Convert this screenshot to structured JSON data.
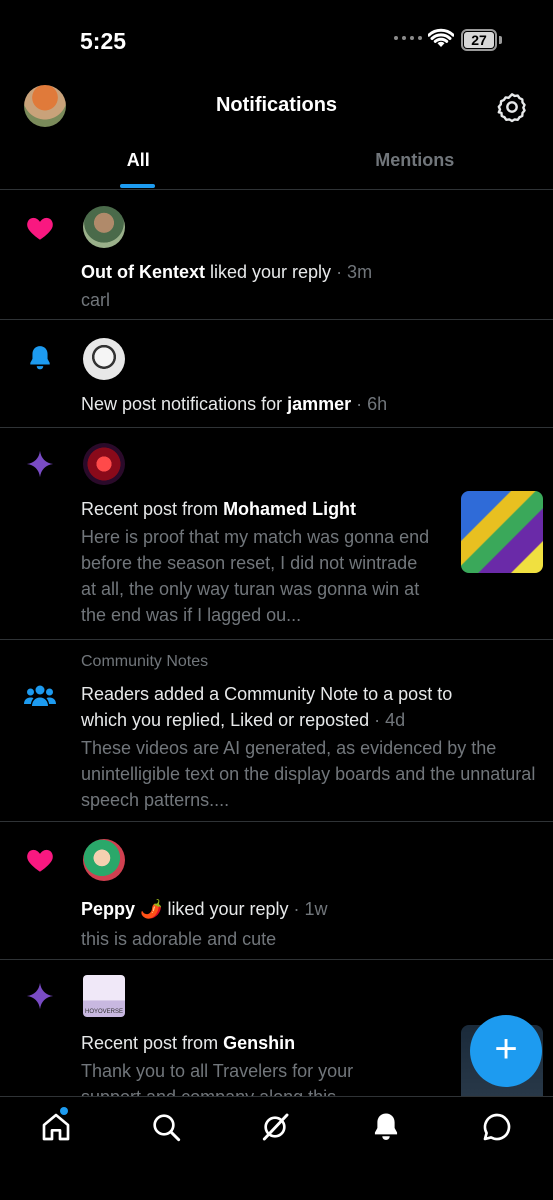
{
  "status": {
    "time": "5:25",
    "battery": "27"
  },
  "header": {
    "title": "Notifications"
  },
  "tabs": [
    {
      "label": "All"
    },
    {
      "label": "Mentions"
    }
  ],
  "notifications": [
    {
      "type": "like",
      "actor": "Out of Kentext",
      "action": " liked your reply",
      "time": " · 3m",
      "preview": "carl"
    },
    {
      "type": "bell",
      "prefix": "New post notifications for ",
      "actor": "jammer",
      "time": " · 6h"
    },
    {
      "type": "recent-post",
      "prefix": "Recent post from ",
      "actor": "Mohamed Light",
      "preview": "Here is proof that my match was gonna end before the season reset, I did not wintrade at all, the only way turan was gonna win at the end was if I lagged ou..."
    },
    {
      "type": "community-notes",
      "category": "Community Notes",
      "text": "Readers added a Community Note to a post to which you replied, Liked or reposted",
      "time": " · 4d",
      "preview": "These videos are AI generated, as evidenced by the unintelligible text on the display boards and the unnatural speech patterns...."
    },
    {
      "type": "like",
      "actor": "Peppy 🌶️",
      "action": " liked your reply",
      "time": " · 1w",
      "preview": "this is adorable and cute"
    },
    {
      "type": "recent-post",
      "prefix": "Recent post from ",
      "actor": "Genshin",
      "avatar_text": "HOYOVERSE",
      "preview": "Thank you to all Travelers for your support and company along this..."
    }
  ],
  "fab": {
    "label": "+"
  },
  "colors": {
    "accent": "#1d9bf0",
    "like": "#f91880",
    "star": "#794bc4",
    "bg": "#000000"
  },
  "nav": [
    "home-icon",
    "search-icon",
    "grok-icon",
    "notifications-bell-icon",
    "messages-icon"
  ]
}
